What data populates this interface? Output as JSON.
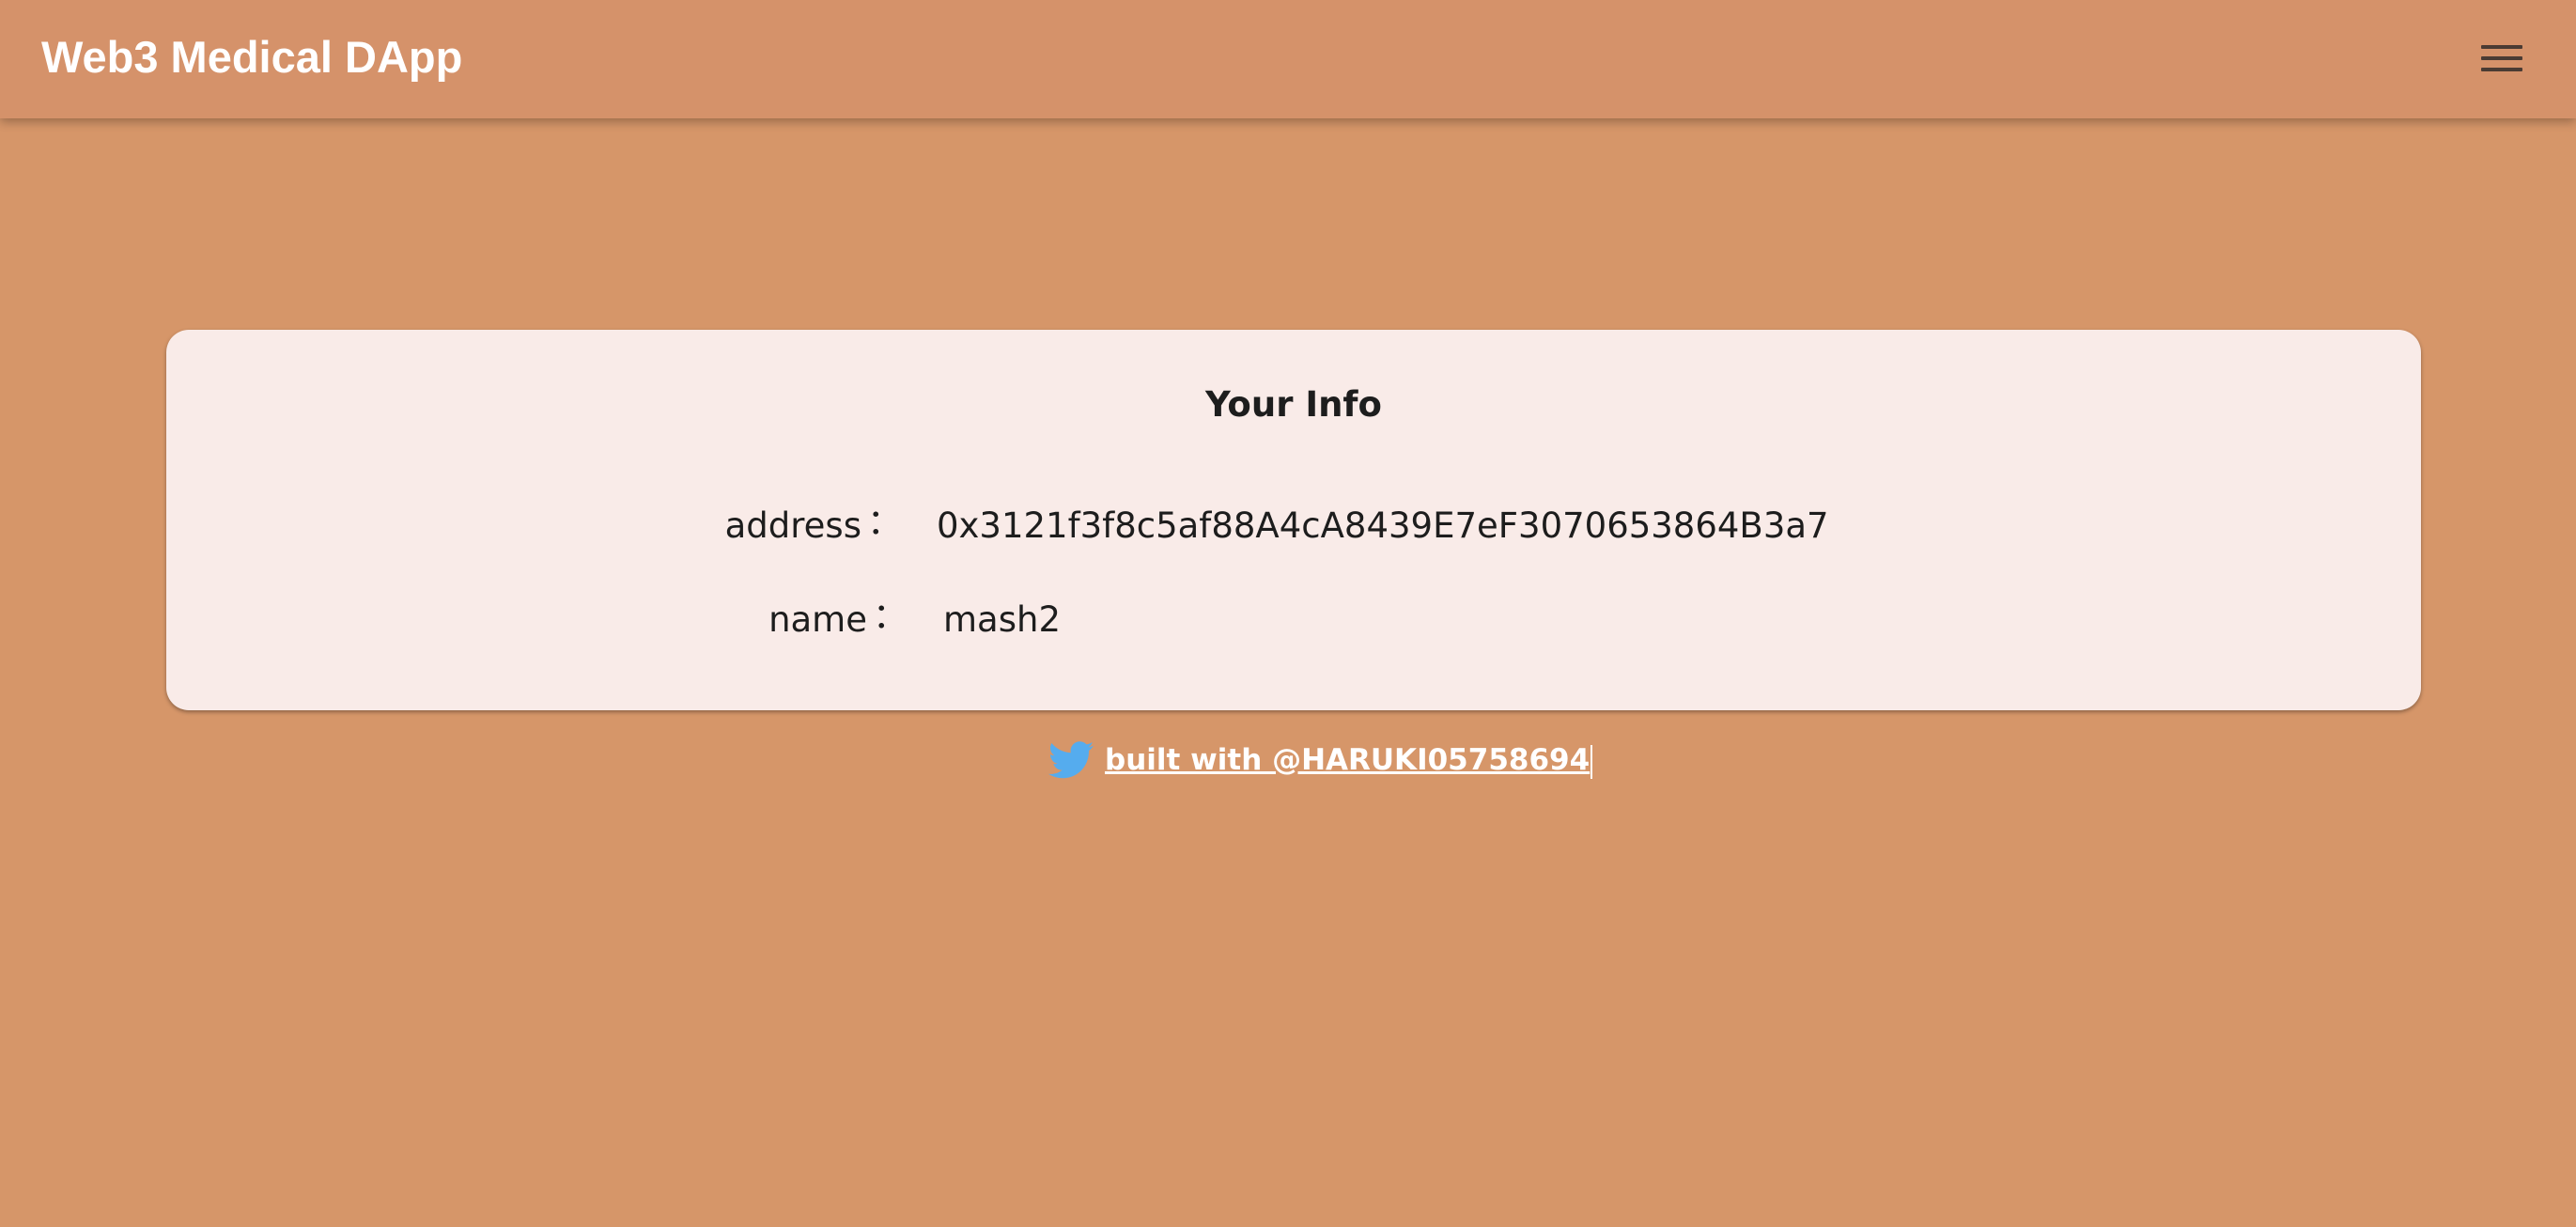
{
  "app": {
    "title": "Web3 Medical DApp"
  },
  "icons": {
    "menu": "menu-icon",
    "twitter": "twitter-icon"
  },
  "info_card": {
    "title": "Your Info",
    "rows": [
      {
        "label": "address",
        "separator": "：",
        "value": "0x3121f3f8c5af88A4cA8439E7eF3070653864B3a7"
      },
      {
        "label": "name",
        "separator": "：",
        "value": "mash2"
      }
    ]
  },
  "footer": {
    "link_text": "built with @HARUKI05758694"
  },
  "colors": {
    "background": "#d69669",
    "app_bar": "#d5926a",
    "card": "#f9ebe8",
    "twitter_blue": "#55acee",
    "text_dark": "#1d1d1d",
    "text_light": "#ffffff"
  }
}
